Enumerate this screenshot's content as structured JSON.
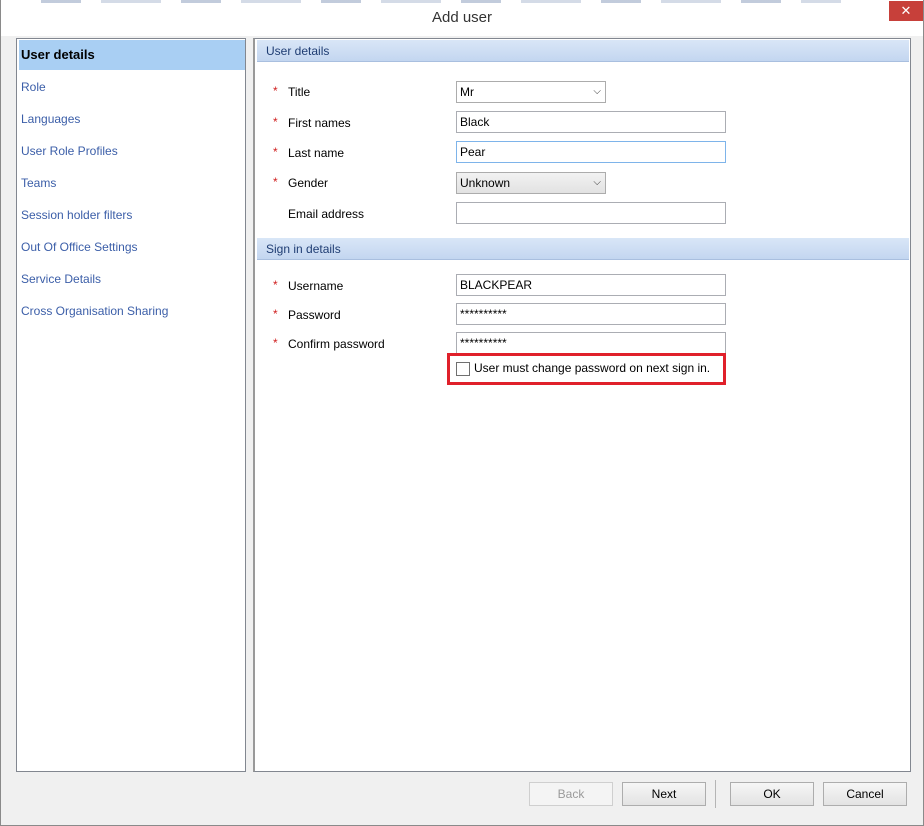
{
  "window": {
    "title": "Add user",
    "close_label": "✕"
  },
  "nav": {
    "items": [
      {
        "label": "User details",
        "active": true
      },
      {
        "label": "Role"
      },
      {
        "label": "Languages"
      },
      {
        "label": "User Role Profiles"
      },
      {
        "label": "Teams"
      },
      {
        "label": "Session holder filters"
      },
      {
        "label": "Out Of Office Settings"
      },
      {
        "label": "Service Details"
      },
      {
        "label": "Cross Organisation Sharing"
      }
    ]
  },
  "user_details": {
    "header": "User details",
    "title_label": "Title",
    "title_value": "Mr",
    "first_names_label": "First names",
    "first_names_value": "Black",
    "last_name_label": "Last name",
    "last_name_value": "Pear",
    "gender_label": "Gender",
    "gender_value": "Unknown",
    "email_label": "Email address",
    "email_value": ""
  },
  "sign_in": {
    "header": "Sign in details",
    "username_label": "Username",
    "username_value": "BLACKPEAR",
    "password_label": "Password",
    "password_value": "**********",
    "confirm_label": "Confirm password",
    "confirm_value": "**********",
    "change_password_label": "User must change password on next sign in.",
    "change_password_checked": false
  },
  "required_marker": "*",
  "footer": {
    "back": "Back",
    "next": "Next",
    "ok": "OK",
    "cancel": "Cancel"
  },
  "colors": {
    "highlight_border": "#e0202a",
    "nav_active": "#a9cff3",
    "link": "#3b5ea8"
  }
}
